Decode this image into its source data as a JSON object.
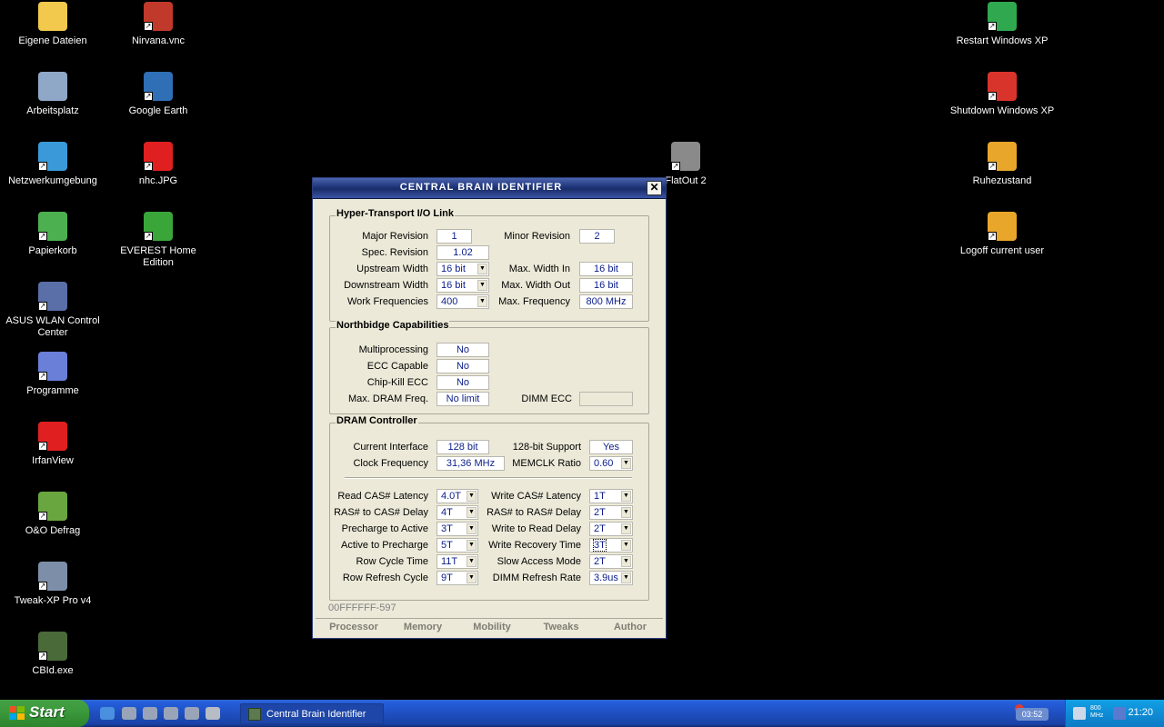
{
  "desktop": {
    "icons": [
      {
        "label": "Eigene Dateien",
        "icon": "folder-documents-icon",
        "color": "#f2c94c"
      },
      {
        "label": "Nirvana.vnc",
        "icon": "vnc-icon",
        "color": "#c0392b"
      },
      {
        "label": "Arbeitsplatz",
        "icon": "my-computer-icon",
        "color": "#8fa8c8"
      },
      {
        "label": "Google Earth",
        "icon": "google-earth-icon",
        "color": "#2f6fb5"
      },
      {
        "label": "Netzwerkumgebung",
        "icon": "network-icon",
        "color": "#3a9ad9"
      },
      {
        "label": "nhc.JPG",
        "icon": "irfanview-image-icon",
        "color": "#e02020"
      },
      {
        "label": "Papierkorb",
        "icon": "recycle-bin-icon",
        "color": "#4caf50"
      },
      {
        "label": "EVEREST Home Edition",
        "icon": "everest-info-icon",
        "color": "#3aa63a"
      },
      {
        "label": "ASUS WLAN Control Center",
        "icon": "wlan-icon",
        "color": "#5a6ea8"
      },
      {
        "label": "Programme",
        "icon": "programs-icon",
        "color": "#6a7fd8"
      },
      {
        "label": "IrfanView",
        "icon": "irfanview-icon",
        "color": "#e02020"
      },
      {
        "label": "O&O Defrag",
        "icon": "defrag-icon",
        "color": "#6aa640"
      },
      {
        "label": "Tweak-XP Pro v4",
        "icon": "tweak-xp-icon",
        "color": "#7d8fa8"
      },
      {
        "label": "CBId.exe",
        "icon": "cbid-exe-icon",
        "color": "#4a6a3a"
      },
      {
        "label": "FlatOut 2",
        "icon": "flatout-icon",
        "color": "#8a8a8a"
      },
      {
        "label": "Restart Windows XP",
        "icon": "restart-icon",
        "color": "#2fa84f"
      },
      {
        "label": "Shutdown Windows XP",
        "icon": "shutdown-icon",
        "color": "#d9342b"
      },
      {
        "label": "Ruhezustand",
        "icon": "hibernate-icon",
        "color": "#e8a62a"
      },
      {
        "label": "Logoff current user",
        "icon": "logoff-icon",
        "color": "#e8a62a"
      }
    ]
  },
  "window": {
    "title": "CENTRAL BRAIN IDENTIFIER",
    "close": "✕",
    "ht": {
      "title": "Hyper-Transport I/O Link",
      "major_revision": {
        "label": "Major Revision",
        "value": "1"
      },
      "minor_revision": {
        "label": "Minor Revision",
        "value": "2"
      },
      "spec_revision": {
        "label": "Spec. Revision",
        "value": "1.02"
      },
      "upstream_width": {
        "label": "Upstream Width",
        "value": "16 bit"
      },
      "max_width_in": {
        "label": "Max. Width In",
        "value": "16 bit"
      },
      "downstream_width": {
        "label": "Downstream Width",
        "value": "16 bit"
      },
      "max_width_out": {
        "label": "Max. Width Out",
        "value": "16 bit"
      },
      "work_frequencies": {
        "label": "Work Frequencies",
        "value": "400"
      },
      "max_frequency": {
        "label": "Max. Frequency",
        "value": "800 MHz"
      }
    },
    "nb": {
      "title": "Northbidge Capabilities",
      "multiprocessing": {
        "label": "Multiprocessing",
        "value": "No"
      },
      "ecc_capable": {
        "label": "ECC Capable",
        "value": "No"
      },
      "chipkill_ecc": {
        "label": "Chip-Kill ECC",
        "value": "No"
      },
      "max_dram_freq": {
        "label": "Max. DRAM Freq.",
        "value": "No limit"
      },
      "dimm_ecc": {
        "label": "DIMM ECC",
        "value": ""
      }
    },
    "dram": {
      "title": "DRAM Controller",
      "current_interface": {
        "label": "Current Interface",
        "value": "128 bit"
      },
      "support_128": {
        "label": "128-bit Support",
        "value": "Yes"
      },
      "clock_frequency": {
        "label": "Clock Frequency",
        "value": "31,36 MHz"
      },
      "memclk_ratio": {
        "label": "MEMCLK Ratio",
        "value": "0.60"
      },
      "read_cas": {
        "label": "Read CAS# Latency",
        "value": "4.0T"
      },
      "write_cas": {
        "label": "Write CAS# Latency",
        "value": "1T"
      },
      "ras_to_cas": {
        "label": "RAS# to CAS# Delay",
        "value": "4T"
      },
      "ras_to_ras": {
        "label": "RAS# to RAS# Delay",
        "value": "2T"
      },
      "precharge_to_active": {
        "label": "Precharge to Active",
        "value": "3T"
      },
      "write_to_read": {
        "label": "Write to Read Delay",
        "value": "2T"
      },
      "active_to_precharge": {
        "label": "Active to Precharge",
        "value": "5T"
      },
      "write_recovery": {
        "label": "Write Recovery Time",
        "value": "3T"
      },
      "row_cycle": {
        "label": "Row Cycle Time",
        "value": "11T"
      },
      "slow_access": {
        "label": "Slow Access Mode",
        "value": "2T"
      },
      "row_refresh": {
        "label": "Row Refresh Cycle",
        "value": "9T"
      },
      "dimm_refresh": {
        "label": "DIMM Refresh Rate",
        "value": "3.9us"
      }
    },
    "device_id": "00FFFFFF-597",
    "tabs": [
      "Processor",
      "Memory",
      "Mobility",
      "Tweaks",
      "Author"
    ]
  },
  "taskbar": {
    "start_label": "Start",
    "task_title": "Central Brain Identifier",
    "tray_time_small": "03:52",
    "cpu_mhz": "800\nMHz",
    "clock": "21:20"
  }
}
